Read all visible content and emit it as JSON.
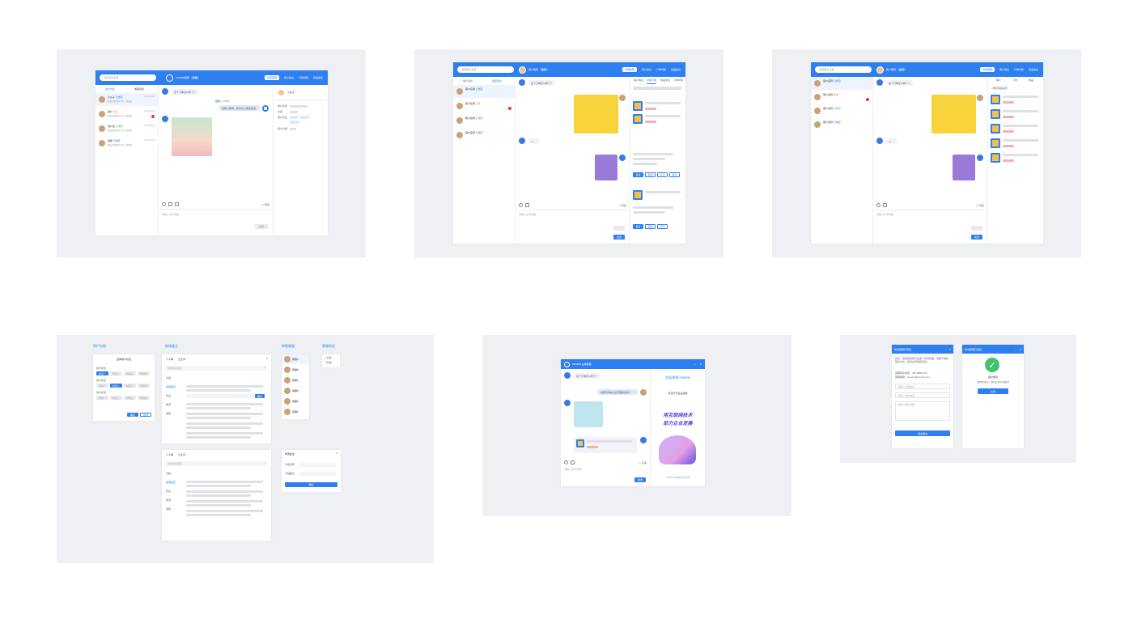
{
  "colors": {
    "accent": "#2f7ff0",
    "board": "#eef0f4",
    "badge_green": "#3ec36e",
    "unread": "#e33"
  },
  "s1": {
    "search": "搜索客户名称",
    "brand": "CRMEB客服",
    "brand_tag": "在线",
    "switch_btn": "切换客服",
    "nav": [
      "客户信息",
      "订单详情",
      "商品信息"
    ],
    "tabs": [
      "用户列表",
      "游客列表"
    ],
    "users": [
      {
        "name": "小丸子",
        "tag": "已绑定",
        "desc": "我这边发货好了吗，谢谢您",
        "time": "2021-03-03"
      },
      {
        "name": "用户",
        "tag": "已读",
        "desc": "我这边发货好了吗，谢谢您",
        "time": "2021-03-03"
      },
      {
        "name": "用户名",
        "tag": "已绑定",
        "desc": "我这边发货好了吗，谢谢您",
        "time": "2021-03-03"
      },
      {
        "name": "游客",
        "tag": "已绑定",
        "desc": "我这边发货好了吗，谢谢您",
        "time": "2021-03-03"
      }
    ],
    "msg1": "这个订单怎么样了?",
    "msg2": "请耐心等待，我们马上帮您查询",
    "time_label": "星期二 19:45",
    "input_placeholder": "请输入文字内容",
    "send": "发送",
    "transfer": "转接",
    "right_name": "小丸子",
    "info_rows": [
      "用户名称",
      "分组",
      "用户标签",
      "用户分组"
    ]
  },
  "s2": {
    "search": "搜索客户名称",
    "title": "客户昵称",
    "title_tag": "在线",
    "switch_btn": "切换客服",
    "nav": [
      "客户信息",
      "订单详情",
      "商品信息"
    ],
    "tabs": [
      "客户信息",
      "交易订单",
      "商品信息",
      "订单详情"
    ],
    "users": [
      {
        "name": "客户名称",
        "tag": "已绑定"
      },
      {
        "name": "客户名称",
        "tag": "游客"
      },
      {
        "name": "客户名称",
        "tag": "已绑定"
      },
      {
        "name": "客户名称",
        "tag": "已绑定"
      }
    ],
    "msg1": "这个订单怎么样了?",
    "send": "发送",
    "transfer": "转接",
    "input_placeholder": "请输入文字内容",
    "order_btns": [
      "发货",
      "退款",
      "打印",
      "备注"
    ]
  },
  "s3": {
    "search": "搜索客户名称",
    "title": "客户昵称",
    "title_tag": "在线",
    "switch_btn": "切换客服",
    "nav": [
      "客户信息",
      "订单详情",
      "商品信息"
    ],
    "tabs": [
      "客户",
      "订单",
      "商品"
    ],
    "product_search": "搜索商品名称",
    "msg1": "这个订单怎么样了?",
    "send": "发送",
    "transfer": "转接",
    "input_placeholder": "请输入文字内容"
  },
  "s4": {
    "labels": [
      "用户分组",
      "修改备注",
      "转接客服",
      "客服状态"
    ],
    "group_title": "选择用户标签",
    "group_rows": [
      "用户标签",
      "用户标签",
      "用户标签"
    ],
    "group_tags": [
      "标签一",
      "标签二",
      "标签三",
      "标签四"
    ],
    "ok": "确定",
    "cancel": "取消",
    "reply_tabs": [
      "个人库",
      "企业库"
    ],
    "reply_search": "搜索快捷回复",
    "reply_groups": [
      "分组",
      "常用回复",
      "售后",
      "物流",
      "其他"
    ],
    "staff": [
      "客服A",
      "客服B",
      "客服C",
      "客服D",
      "客服E",
      "客服F"
    ],
    "status": [
      "在线",
      "离线"
    ],
    "remark_title": "修改备注",
    "remark_rows": [
      "分组名称",
      "分组备注"
    ],
    "remark_btn": "确定"
  },
  "s5": {
    "title": "CRMEB 在线客服",
    "msg1": "这个订单怎么样了?",
    "msg2": "小程序商城以后可帮助您吗？",
    "banner1": "欢迎来到CRMEB",
    "banner2": "专注于为企业提供",
    "banner3": "用互联网技术",
    "banner4": "助力企业发展",
    "input_placeholder": "请输入文字内容",
    "send": "发送",
    "transfer": "表情",
    "footer": "CRMEB 提供技术支持"
  },
  "s6": {
    "title1": "商城客服已离线",
    "notice": "您好，您的留言我们会第一时间处理，请留下您的联系方式，我们会尽快联系您。",
    "contact1": "客服联系电话：400-8888-794",
    "contact2": "客服邮箱：support@crmeb.com",
    "fields": [
      "请输入您的姓名",
      "请输入联系电话",
      "请输入留言内容"
    ],
    "submit": "提交留言",
    "title2": "商城客服已离线",
    "success": "提交成功",
    "success_desc": "感谢您的留言，我们会尽快与您联系",
    "close": "关闭"
  }
}
